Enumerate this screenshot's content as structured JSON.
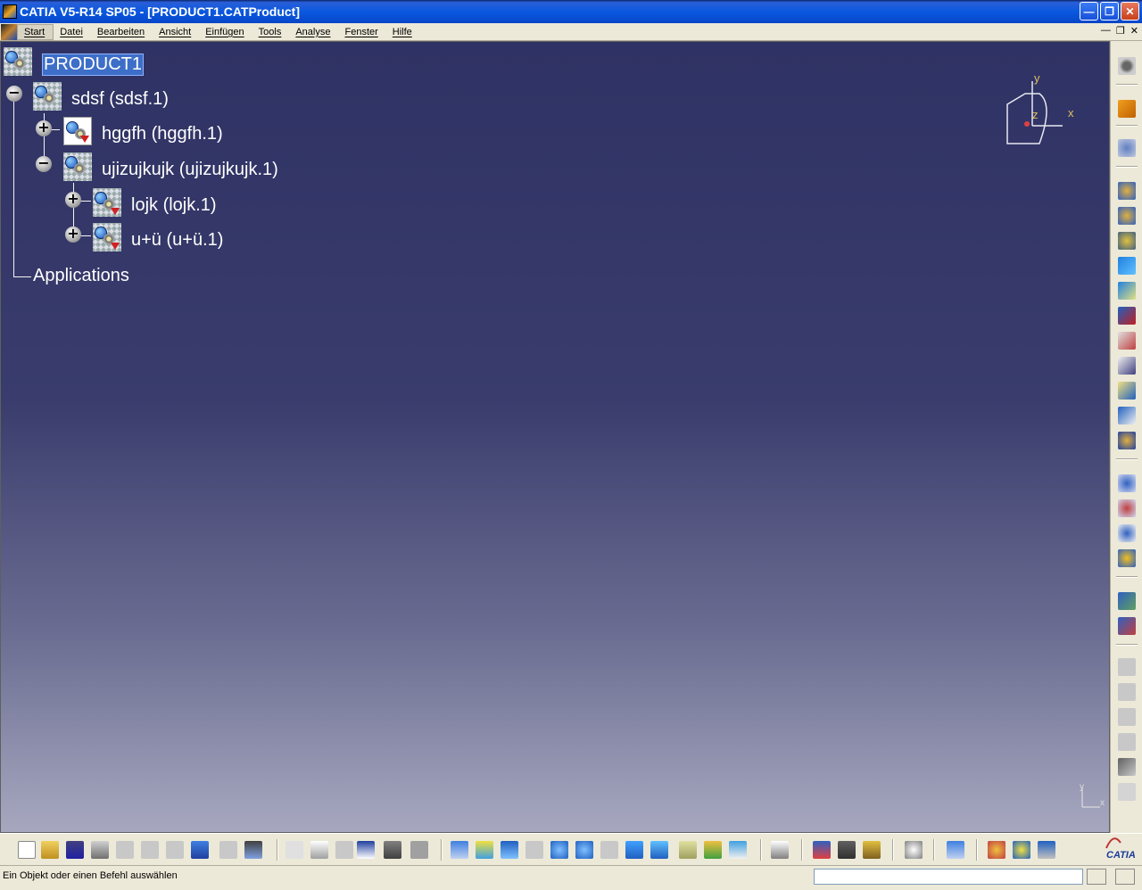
{
  "window": {
    "title": "CATIA V5-R14 SP05 - [PRODUCT1.CATProduct]"
  },
  "menu": {
    "items": [
      "Start",
      "Datei",
      "Bearbeiten",
      "Ansicht",
      "Einfügen",
      "Tools",
      "Analyse",
      "Fenster",
      "Hilfe"
    ],
    "active": "Start"
  },
  "tree": {
    "root": "PRODUCT1",
    "nodes": [
      {
        "label": "sdsf (sdsf.1)",
        "state": "expanded"
      },
      {
        "label": "hggfh (hggfh.1)",
        "state": "collapsed"
      },
      {
        "label": "ujizujkujk (ujizujkujk.1)",
        "state": "expanded"
      },
      {
        "label": "lojk (lojk.1)",
        "state": "collapsed"
      },
      {
        "label": "u+ü (u+ü.1)",
        "state": "collapsed"
      }
    ],
    "applications": "Applications"
  },
  "compass": {
    "x": "x",
    "y": "y",
    "z": "z"
  },
  "axis_triad": {
    "x": "x",
    "y": "y"
  },
  "status": {
    "message": "Ein Objekt oder einen Befehl auswählen",
    "command_input": ""
  },
  "logo": {
    "text": "CATIA"
  },
  "colors": {
    "viewport_top": "#2f3264",
    "viewport_bottom": "#a7a8bf",
    "selection": "#3d6ec8",
    "titlebar": "#0a58e0"
  },
  "icons": {
    "right_toolbar": [
      "select-icon",
      "fly-mode-icon",
      "new-component-icon",
      "new-product-icon",
      "new-part-icon",
      "existing-component-icon",
      "replace-component-icon",
      "graph-tree-reorder-icon",
      "generate-numbering-icon",
      "selective-load-icon",
      "manage-representations-icon",
      "multi-instantiation-icon",
      "manipulation-icon",
      "snap-icon",
      "explode-icon",
      "stop-manipulate-icon",
      "fix-constraint-icon",
      "contact-constraint-icon",
      "offset-constraint-icon",
      "angle-constraint-icon",
      "fix-together-icon",
      "update-icon"
    ],
    "bottom_toolbar": [
      "new-icon",
      "open-icon",
      "save-icon",
      "print-icon",
      "cut-icon",
      "copy-icon",
      "paste-icon",
      "undo-icon",
      "redo-icon",
      "whats-this-icon",
      "formula-icon",
      "comment-icon",
      "knowledge-icon",
      "table-icon",
      "lock-icon",
      "catalog-icon",
      "fly-icon",
      "fit-all-icon",
      "pan-icon",
      "rotate-icon",
      "zoom-in-icon",
      "zoom-out-icon",
      "normal-view-icon",
      "multi-view-icon",
      "iso-view-icon",
      "shading-icon",
      "hide-show-icon",
      "swap-space-icon",
      "measure-icon",
      "measure-between-icon",
      "measure-inertia-icon",
      "clash-icon",
      "scene-icon",
      "render-icon",
      "material-icon",
      "lights-icon"
    ]
  }
}
